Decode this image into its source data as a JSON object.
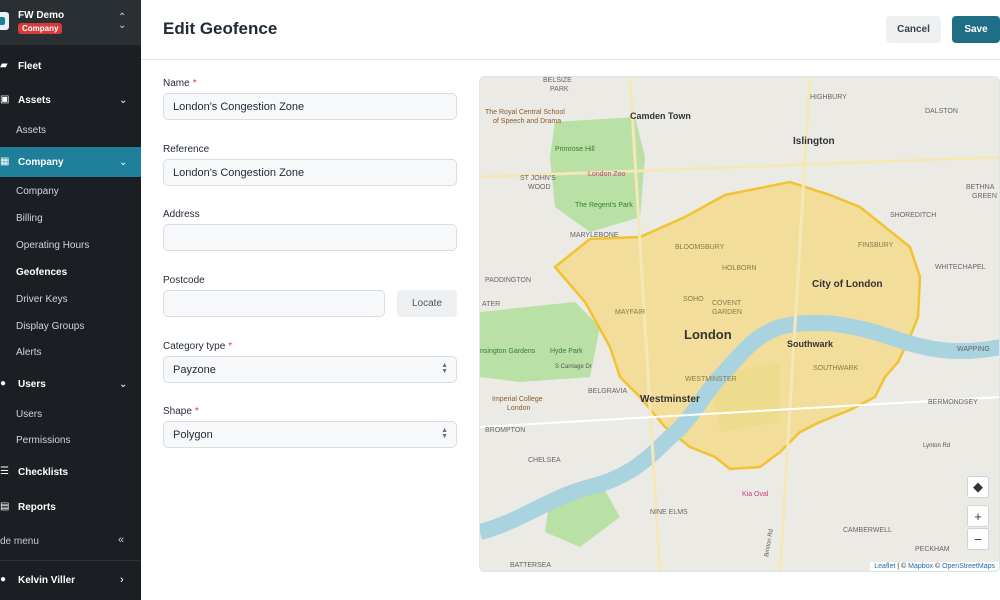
{
  "org": {
    "name": "FW Demo",
    "badge": "Company"
  },
  "nav": {
    "fleet": "Fleet",
    "assets": "Assets",
    "assets_sub": [
      "Assets"
    ],
    "company": "Company",
    "company_sub": [
      "Company",
      "Billing",
      "Operating Hours",
      "Geofences",
      "Driver Keys",
      "Display Groups",
      "Alerts"
    ],
    "users": "Users",
    "users_sub": [
      "Users",
      "Permissions"
    ],
    "checklists": "Checklists",
    "reports": "Reports",
    "hide_menu": "de menu"
  },
  "user": {
    "name": "Kelvin Viller"
  },
  "header": {
    "title": "Edit Geofence",
    "cancel": "Cancel",
    "save": "Save"
  },
  "form": {
    "name_label": "Name",
    "name_value": "London's Congestion Zone",
    "reference_label": "Reference",
    "reference_value": "London's Congestion Zone",
    "address_label": "Address",
    "address_value": "",
    "postcode_label": "Postcode",
    "postcode_value": "",
    "locate": "Locate",
    "category_label": "Category type",
    "category_value": "Payzone",
    "shape_label": "Shape",
    "shape_value": "Polygon",
    "required_mark": "*"
  },
  "map": {
    "labels": {
      "camden": "Camden Town",
      "islington": "Islington",
      "london": "London",
      "city": "City of London",
      "southwark": "Southwark",
      "westminster": "Westminster",
      "hyde_park": "Hyde Park",
      "regents_park": "The Regent's Park",
      "primrose": "Primrose Hill",
      "nine_elms": "NINE ELMS",
      "chelsea": "CHELSEA",
      "battersea": "BATTERSEA",
      "brompton": "BROMPTON",
      "belgravia": "BELGRAVIA",
      "bloomsbury": "BLOOMSBURY",
      "holborn": "HOLBORN",
      "soho": "SOHO",
      "covent": "COVENT",
      "garden": "GARDEN",
      "mayfair": "MAYFAIR",
      "marylebone": "MARYLEBONE",
      "paddington": "PADDINGTON",
      "finsbury": "FINSBURY",
      "whitechapel": "WHITECHAPEL",
      "highbury": "HIGHBURY",
      "dalston": "DALSTON",
      "bermondsey": "BERMONDSEY",
      "wapping": "WAPPING",
      "camberwell": "CAMBERWELL",
      "peckham": "PECKHAM",
      "belsize": "BELSIZE",
      "park": "PARK",
      "st_johns": "ST JOHN'S",
      "wood": "WOOD",
      "kia_oval": "Kia Oval",
      "london_zoo": "London Zoo",
      "imperial": "Imperial College",
      "imperial2": "London",
      "rcssd": "The Royal Central School",
      "rcssd2": "of Speech and Drama",
      "lynton": "Lynton Rd",
      "s_carriage": "S Carriage Dr",
      "south_sw": "SOUTHWARK",
      "westminster_small": "WESTMINSTER",
      "shoreditch": "SHOREDITCH",
      "bethnal": "BETHNA",
      "green": "GREEN",
      "ater": "ATER",
      "gardens": "nsington Gardens",
      "brixton": "Brixton Rd"
    },
    "zoom_in": "+",
    "zoom_out": "−",
    "attribution": {
      "leaflet": "Leaflet",
      "sep": " | © ",
      "mapbox": "Mapbox",
      "osm": "OpenStreetMaps"
    },
    "colors": {
      "zone_fill": "#f5d77a",
      "zone_stroke": "#f2c230",
      "water": "#a9d3df",
      "park": "#b9e0a5"
    }
  }
}
